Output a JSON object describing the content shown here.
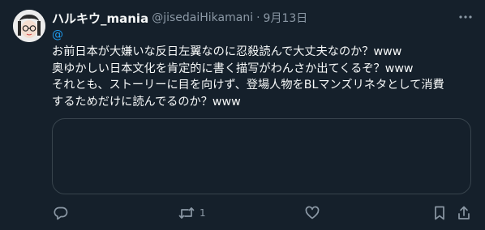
{
  "tweet": {
    "display_name": "ハルキウ_mania",
    "handle": "@jisedaiHikamani",
    "separator": "·",
    "date": "9月13日",
    "mention": "@",
    "lines": [
      "お前日本が大嫌いな反日左翼なのに忍殺読んで大丈夫なのか？www",
      "奥ゆかしい日本文化を肯定的に書く描写がわんさか出てくるぞ？www",
      "それとも、ストーリーに目を向けず、登場人物をBLマンズリネタとして消費",
      "するためだけに読んでるのか？www"
    ],
    "retweet_count": "1"
  },
  "icons": {
    "more": "more-horizontal-icon",
    "reply": "reply-icon",
    "retweet": "retweet-icon",
    "like": "heart-icon",
    "bookmark": "bookmark-icon",
    "share": "share-icon"
  },
  "colors": {
    "background": "#15202b",
    "text": "#f7f9f9",
    "secondary": "#8b98a5",
    "accent": "#1d9bf0",
    "border": "#38444d"
  }
}
